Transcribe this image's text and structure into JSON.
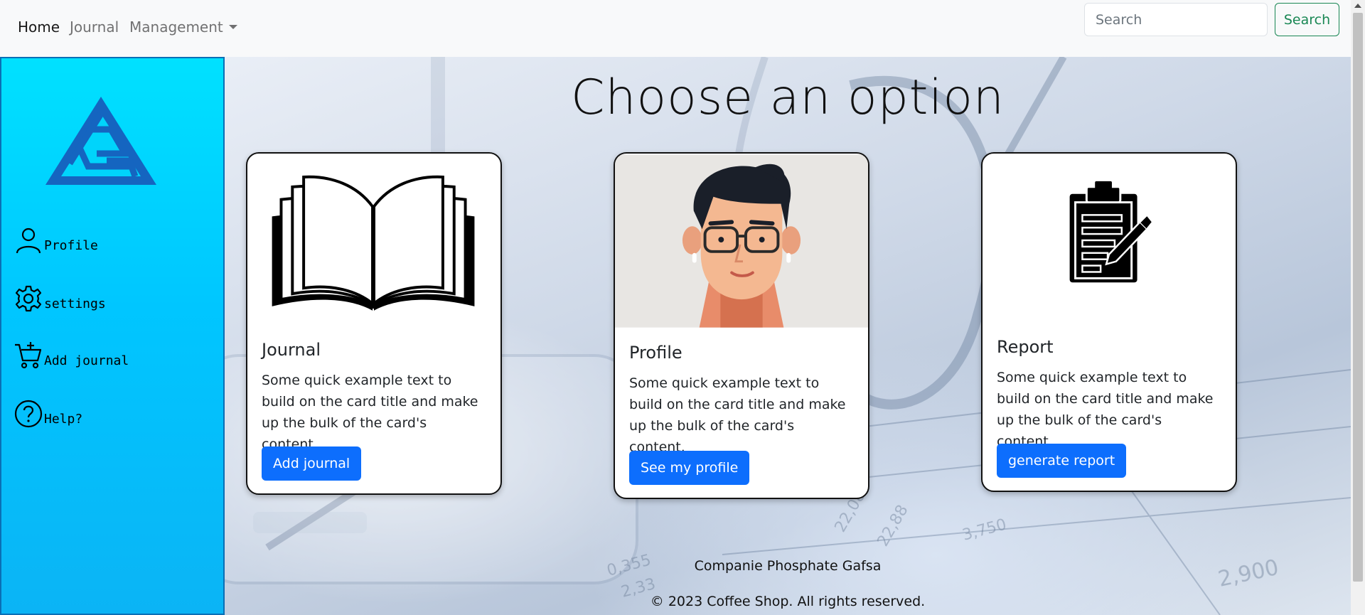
{
  "nav": {
    "home": "Home",
    "journal": "Journal",
    "management": "Management",
    "search_placeholder": "Search",
    "search_button": "Search"
  },
  "sidebar": {
    "logo_icon": "company-logo-triangle",
    "items": [
      {
        "label": "Profile",
        "icon": "person-icon"
      },
      {
        "label": "settings",
        "icon": "gear-icon"
      },
      {
        "label": "Add journal",
        "icon": "cart-plus-icon"
      },
      {
        "label": "Help?",
        "icon": "question-circle-icon"
      }
    ]
  },
  "main": {
    "title": "Choose an option",
    "cards": [
      {
        "title": "Journal",
        "text": "Some quick example text to build on the card title and make up the bulk of the card's content.",
        "button": "Add journal",
        "image": "open-book-image"
      },
      {
        "title": "Profile",
        "text": "Some quick example text to build on the card title and make up the bulk of the card's content.",
        "button": "See my profile",
        "image": "man-avatar-image"
      },
      {
        "title": "Report",
        "text": "Some quick example text to build on the card title and make up the bulk of the card's content.",
        "button": "generate report",
        "image": "clipboard-report-image"
      }
    ]
  },
  "footer": {
    "company": "Companie Phosphate Gafsa",
    "copyright": "© 2023 Coffee Shop. All rights reserved."
  },
  "colors": {
    "primary": "#0d6efd",
    "success": "#198754",
    "sidebar_top": "#00e1ff",
    "sidebar_bottom": "#0bb4f5",
    "logo": "#1565c0"
  }
}
